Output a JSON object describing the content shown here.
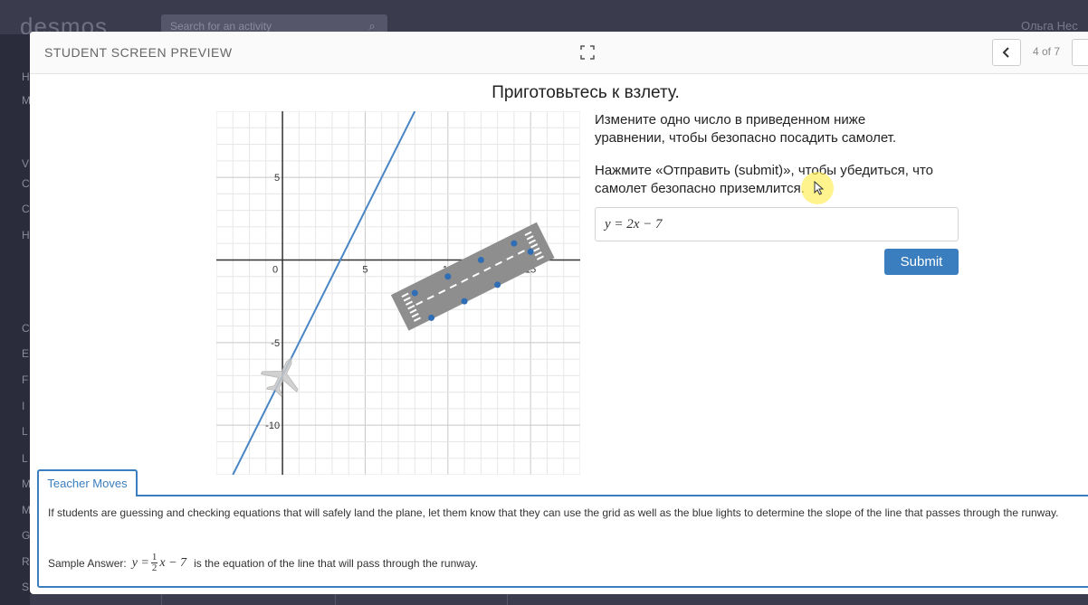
{
  "background": {
    "logo": "desmos",
    "search_placeholder": "Search for an activity",
    "user_name": "Ольга Нес",
    "sidebar_letters": [
      "H",
      "M",
      "V",
      "C",
      "C",
      "H",
      "C",
      "E",
      "F",
      "I",
      "L",
      "L",
      "M",
      "M",
      "G",
      "R",
      "S"
    ]
  },
  "header": {
    "title": "STUDENT SCREEN PREVIEW",
    "page_count": "4 of 7"
  },
  "screen": {
    "title": "Приготовьтесь к взлету.",
    "instruction_1": "Измените одно число в приведенном ниже уравнении, чтобы безопасно посадить самолет.",
    "instruction_2": "Нажмите «Отправить (submit)», чтобы убедиться, что самолет безопасно приземлится.",
    "equation": "y = 2x − 7",
    "submit_label": "Submit"
  },
  "graph": {
    "x_ticks": [
      "0",
      "5",
      "10",
      "15"
    ],
    "y_ticks": [
      "5",
      "-5",
      "-10"
    ],
    "xlim": [
      -4,
      18
    ],
    "ylim": [
      -13,
      9
    ],
    "line": {
      "slope": 2,
      "intercept": -7,
      "color": "#4a86c5"
    },
    "lights": [
      [
        8,
        -2
      ],
      [
        9,
        -3.5
      ],
      [
        10,
        -1
      ],
      [
        11,
        -2.5
      ],
      [
        12,
        0
      ],
      [
        13,
        -1.5
      ],
      [
        14,
        1
      ],
      [
        15,
        0.5
      ]
    ],
    "runway_color": "#8e8e8e",
    "light_color": "#2f6db5"
  },
  "teacher_moves": {
    "tab_label": "Teacher Moves",
    "text": "If students are guessing and checking equations that will safely land the plane, let them know that they can use the grid as well as the blue lights to determine the slope of the line that passes through the runway.",
    "sample_label": "Sample Answer:",
    "sample_eq_prefix": "y =",
    "sample_frac_num": "1",
    "sample_frac_den": "2",
    "sample_eq_suffix": "x − 7",
    "sample_suffix": "is the equation of the line that will pass through the runway."
  }
}
